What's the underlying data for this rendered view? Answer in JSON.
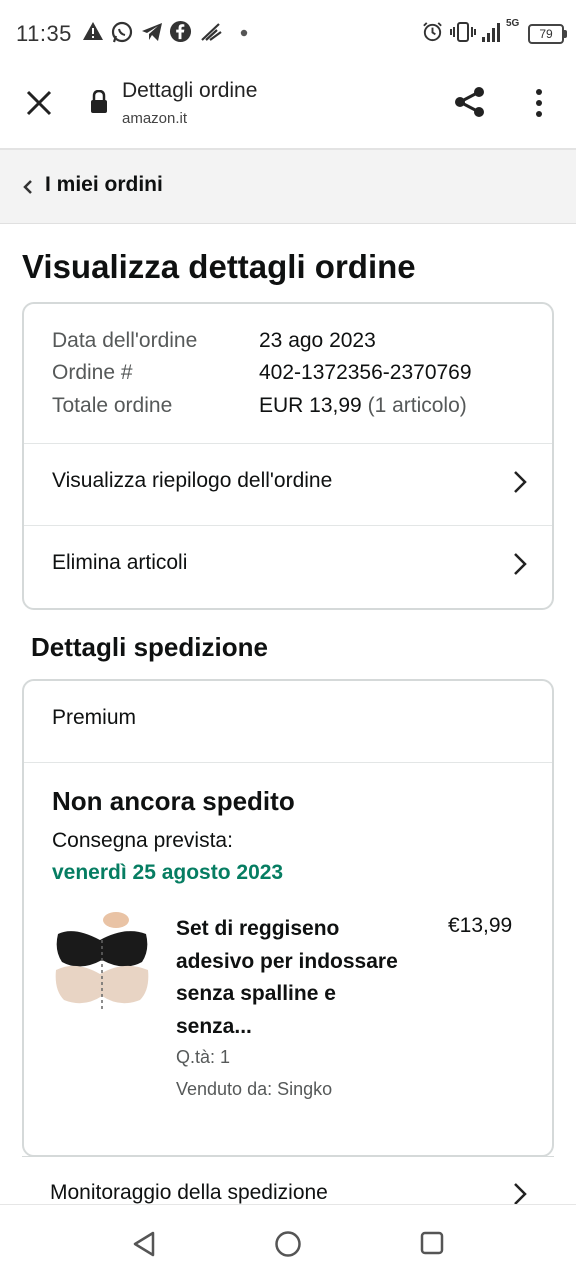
{
  "status_bar": {
    "time": "11:35",
    "battery": "79",
    "network": "5G",
    "icons": [
      "warning-icon",
      "whatsapp-icon",
      "telegram-icon",
      "facebook-icon",
      "app-icon",
      "dot-icon",
      "alarm-icon",
      "vibrate-icon",
      "signal-icon",
      "battery-icon"
    ]
  },
  "browser": {
    "title": "Dettagli ordine",
    "domain": "amazon.it",
    "icons": [
      "close-icon",
      "lock-icon",
      "share-icon",
      "more-icon"
    ]
  },
  "breadcrumb": {
    "label": "I miei ordini"
  },
  "page": {
    "title": "Visualizza dettagli ordine"
  },
  "order_summary": {
    "rows": [
      {
        "label": "Data dell'ordine",
        "value": "23 ago 2023"
      },
      {
        "label": "Ordine #",
        "value": "402-1372356-2370769"
      },
      {
        "label": "Totale ordine",
        "value": "EUR 13,99",
        "extra": "(1 articolo)"
      }
    ],
    "links": [
      {
        "label": "Visualizza riepilogo dell'ordine"
      },
      {
        "label": "Elimina articoli"
      }
    ]
  },
  "shipping": {
    "title": "Dettagli spedizione",
    "method": "Premium",
    "status": "Non ancora spedito",
    "delivery_label": "Consegna prevista:",
    "delivery_date": "venerdì 25 agosto 2023",
    "product": {
      "title": "Set di reggiseno adesivo per indossare senza spalline e senza...",
      "price": "€13,99",
      "qty": "Q.tà: 1",
      "seller": "Venduto da: Singko"
    },
    "tracking_label": "Monitoraggio della spedizione"
  },
  "nav": {
    "icons": [
      "back-nav-icon",
      "home-nav-icon",
      "recents-nav-icon"
    ]
  }
}
